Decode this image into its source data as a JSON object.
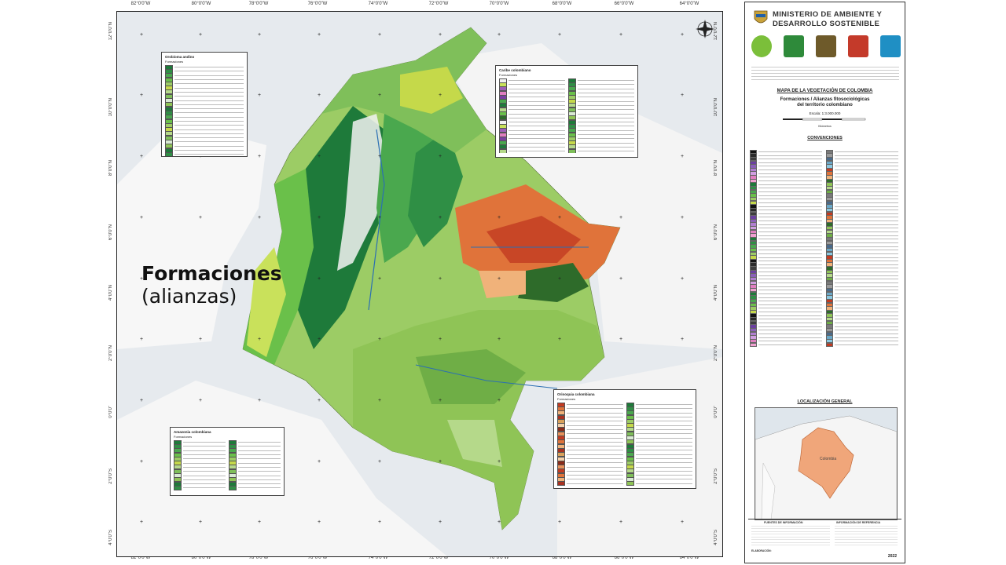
{
  "overlay": {
    "line1": "Formaciones",
    "line2": "(alianzas)"
  },
  "graticule": {
    "longitudes": [
      "82°0'0\"W",
      "80°0'0\"W",
      "78°0'0\"W",
      "76°0'0\"W",
      "74°0'0\"W",
      "72°0'0\"W",
      "70°0'0\"W",
      "68°0'0\"W",
      "66°0'0\"W",
      "64°0'0\"W"
    ],
    "latitudes": [
      "12°0'0\"N",
      "10°0'0\"N",
      "8°0'0\"N",
      "6°0'0\"N",
      "4°0'0\"N",
      "2°0'0\"N",
      "0°0'0\"",
      "2°0'0\"S",
      "4°0'0\"S"
    ]
  },
  "legends": {
    "andean": {
      "title": "Orobioma andino",
      "subtitle": "Formaciones"
    },
    "caribbean": {
      "title": "Caribe colombiano",
      "subtitle": "Formaciones"
    },
    "amazon": {
      "title": "Amazonia colombiana",
      "subtitle": "Formaciones"
    },
    "orinoquia": {
      "title": "Orinoquia colombiana",
      "subtitle": "Formaciones"
    }
  },
  "panel": {
    "ministry_line1": "MINISTERIO DE AMBIENTE Y",
    "ministry_line2": "DESARROLLO SOSTENIBLE",
    "map_title": "MAPA DE LA VEGETACIÓN DE COLOMBIA",
    "map_subtitle1": "Formaciones / Alianzas fitosociológicas",
    "map_subtitle2": "del territorio colombiano",
    "scale": "Escala: 1:3.000.000",
    "scale_unit": "Kilómetros",
    "conventions_title": "CONVENCIONES",
    "location_title": "LOCALIZACIÓN GENERAL",
    "location_label": "Colombia",
    "sources_title": "FUENTES DE INFORMACIÓN",
    "reference_title": "INFORMACIÓN DE REFERENCIA",
    "elaboration": "ELABORACIÓN:",
    "year": "2022"
  },
  "colors": {
    "andes_dark": "#1e7a3a",
    "andes_mid": "#4aa84e",
    "llanos_orange": "#e0733a",
    "llanos_red": "#c23b22",
    "amazon_light": "#9ccc65",
    "pacific_green": "#6ac04a",
    "caribbean_mix": "#7fbf5a",
    "highland_white": "#f2f2f2",
    "location_fill": "#f0a67a"
  }
}
